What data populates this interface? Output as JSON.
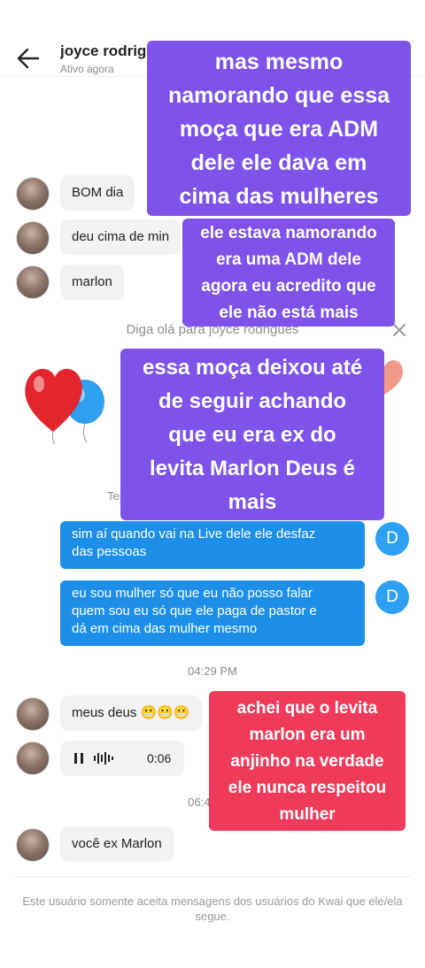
{
  "header": {
    "contact_name": "joyce rodrigues",
    "status": "Ativo agora",
    "back_icon": "arrow-left-icon",
    "more_icon": "more-vertical-icon"
  },
  "messages_top": [
    {
      "text": "BOM dia"
    },
    {
      "text": "deu cima de min"
    },
    {
      "text": "marlon"
    }
  ],
  "intro": {
    "greeting": "Diga olá para joyce rodrigues",
    "subtitle": "Tenha uma conversa de ma                    a e amigável"
  },
  "outgoing": [
    {
      "line1": "sim aí quando vai na Live dele ele desfaz",
      "line2": "das pessoas",
      "avatar": "D"
    },
    {
      "line1": "eu sou mulher só que eu não posso falar",
      "line2": "quem sou eu só que ele paga de pastor e",
      "line3": "dá em cima das mulher mesmo",
      "avatar": "D"
    }
  ],
  "timestamps": [
    "04:29 PM",
    "06:47 PM"
  ],
  "messages_bottom": [
    {
      "text": "meus deus 😬😬😬"
    },
    {
      "voice_duration": "0:06"
    },
    {
      "text": "você ex Marlon"
    }
  ],
  "overlays": {
    "box1": [
      "mas mesmo",
      "namorando que   essa",
      "moça que era ADM",
      "dele ele dava em",
      "cima das mulheres"
    ],
    "box2": [
      "ele estava namorando",
      "era uma ADM dele",
      "agora eu acredito que",
      "ele não está mais"
    ],
    "box3": [
      "essa moça deixou até",
      "de seguir achando",
      "que eu era ex do",
      "levita Marlon Deus é",
      "mais"
    ],
    "box4": [
      "achei que o levita",
      "marlon era um",
      "anjinho na verdade",
      "ele  nunca respeitou",
      "mulher"
    ]
  },
  "footer": {
    "note": "Este usuário somente aceita mensagens dos usuários do Kwai que ele/ela segue."
  },
  "colors": {
    "outgoing_bubble": "#1d8fe8",
    "overlay_purple": "#7f52ea",
    "overlay_red": "#ef3a59"
  }
}
